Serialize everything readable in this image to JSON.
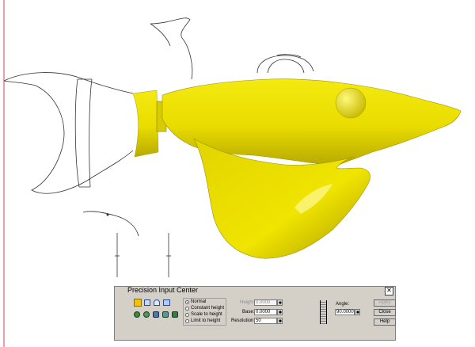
{
  "dialog": {
    "title": "Precision Input Center",
    "close_label": "✕",
    "modes": [
      {
        "label": "Normal",
        "selected": true
      },
      {
        "label": "Constant height",
        "selected": false
      },
      {
        "label": "Scale to height",
        "selected": false
      },
      {
        "label": "Limit to height",
        "selected": false
      }
    ],
    "height_label": "Height:",
    "height_value": "0.0000",
    "base_label": "Base:",
    "base_value": "0.0000",
    "resolution_label": "Resolution:",
    "resolution_value": "50",
    "angle_label": "Angle:",
    "angle_value": "90.0000",
    "buttons": {
      "apply": "Apply",
      "close": "Close",
      "help": "Help"
    }
  },
  "colors": {
    "model_fill": "#f2e600",
    "model_shade": "#b8a800",
    "dialog_bg": "#d4d0c8",
    "guide_line": "#e23c5a"
  }
}
